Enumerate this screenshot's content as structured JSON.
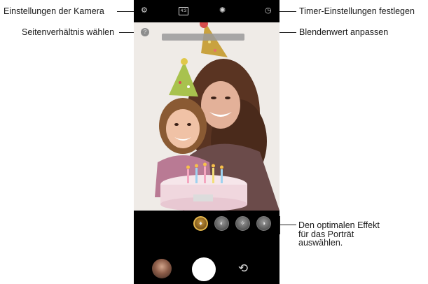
{
  "callouts": {
    "camera_settings": "Einstellungen der Kamera",
    "aspect_ratio": "Seitenverhältnis wählen",
    "timer": "Timer-Einstellungen festlegen",
    "aperture": "Blendenwert anpassen",
    "portrait_effect": "Den optimalen Effekt für das Porträt auswählen."
  },
  "topbar": {
    "settings_icon": "gear-icon",
    "ratio_icon": "aspect-ratio-icon",
    "ratio_label": "4:3",
    "aperture_icon": "aperture-icon",
    "timer_icon": "timer-icon"
  },
  "viewfinder": {
    "help_icon": "question-icon",
    "help_glyph": "?",
    "subject": "mother and daughter with party hats and birthday cake"
  },
  "effects": [
    "effect-1",
    "effect-2",
    "effect-3",
    "effect-4"
  ],
  "modes": [
    "",
    "",
    "",
    "",
    ""
  ],
  "colors": {
    "selected_effect": "#e3b54a",
    "phone_bg": "#000000",
    "shutter": "#ffffff"
  }
}
